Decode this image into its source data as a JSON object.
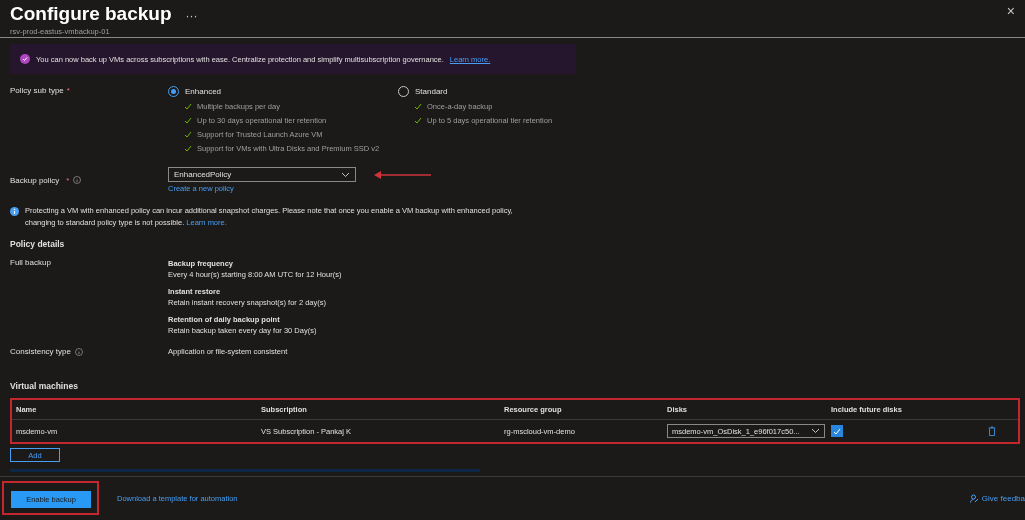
{
  "header": {
    "title": "Configure backup",
    "more": "···",
    "subtitle": "rsv-prod-eastus-vmbackup-01",
    "close": "×"
  },
  "banner": {
    "text": "You can now back up VMs across subscriptions with ease. Centralize protection and simplify multisubscription governance.",
    "link": "Learn more."
  },
  "policy_sub_type": {
    "label": "Policy sub type",
    "required_mark": "*",
    "options": [
      {
        "label": "Enhanced",
        "selected": true,
        "features": [
          "Multiple backups per day",
          "Up to 30 days operational tier retention",
          "Support for Trusted Launch Azure VM",
          "Support for VMs with Ultra Disks and Premium SSD v2"
        ]
      },
      {
        "label": "Standard",
        "selected": false,
        "features": [
          "Once-a-day backup",
          "Up to 5 days operational tier retention"
        ]
      }
    ]
  },
  "backup_policy": {
    "label": "Backup policy",
    "required_mark": "*",
    "value": "EnhancedPolicy",
    "create_link": "Create a new policy"
  },
  "info": {
    "text": "Protecting a VM with enhanced policy can incur additional snapshot charges. Please note that once you enable a VM backup with enhanced policy, changing to standard policy type is not possible.",
    "link": "Learn more."
  },
  "policy_details": {
    "heading": "Policy details",
    "full_backup_label": "Full backup",
    "items": [
      {
        "title": "Backup frequency",
        "text": "Every 4 hour(s) starting 8:00 AM UTC for 12 Hour(s)"
      },
      {
        "title": "Instant restore",
        "text": "Retain instant recovery snapshot(s) for 2 day(s)"
      },
      {
        "title": "Retention of daily backup point",
        "text": "Retain backup taken every day for 30 Day(s)"
      }
    ],
    "consistency_label": "Consistency type",
    "consistency_value": "Application or file-system consistent"
  },
  "virtual_machines": {
    "heading": "Virtual machines",
    "columns": [
      "Name",
      "Subscription",
      "Resource group",
      "Disks",
      "Include future disks"
    ],
    "rows": [
      {
        "name": "msdemo-vm",
        "subscription": "VS Subscription - Pankaj K",
        "resource_group": "rg-mscloud-vm-demo",
        "disks": "msdemo-vm_OsDisk_1_e96f017c50...",
        "include_future_disks": true
      }
    ],
    "add": "Add"
  },
  "footer": {
    "primary": "Enable backup",
    "link": "Download a template for automation",
    "feedback": "Give feedba"
  }
}
